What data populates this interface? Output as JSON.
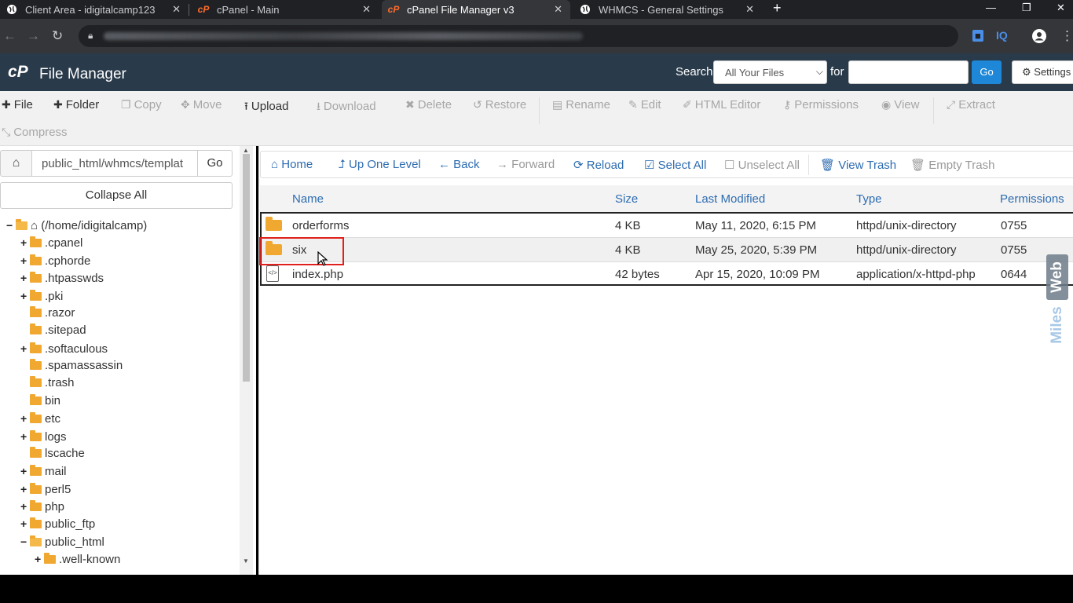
{
  "browser": {
    "tabs": [
      {
        "label": "Client Area - idigitalcamp123",
        "active": false
      },
      {
        "label": "cPanel - Main",
        "active": false
      },
      {
        "label": "cPanel File Manager v3",
        "active": true
      },
      {
        "label": "WHMCS - General Settings",
        "active": false
      }
    ],
    "new_tab": "+",
    "extension_badge": "IQ"
  },
  "header": {
    "title": "File Manager",
    "logo": "cP",
    "search_label": "Search",
    "search_scope": "All Your Files",
    "for_label": "for",
    "search_value": "",
    "go_label": "Go",
    "settings_label": "Settings"
  },
  "toolbar": {
    "items": [
      {
        "label": "File",
        "icon": "plus-icon",
        "enabled": true
      },
      {
        "label": "Folder",
        "icon": "plus-icon",
        "enabled": true
      },
      {
        "label": "Copy",
        "icon": "copy-icon",
        "enabled": false
      },
      {
        "label": "Move",
        "icon": "move-icon",
        "enabled": false
      },
      {
        "label": "Upload",
        "icon": "upload-icon",
        "enabled": true
      },
      {
        "label": "Download",
        "icon": "download-icon",
        "enabled": false
      },
      {
        "label": "Delete",
        "icon": "delete-icon",
        "enabled": false
      },
      {
        "label": "Restore",
        "icon": "restore-icon",
        "enabled": false
      },
      {
        "label": "Rename",
        "icon": "rename-icon",
        "enabled": false
      },
      {
        "label": "Edit",
        "icon": "pencil-icon",
        "enabled": false
      },
      {
        "label": "HTML Editor",
        "icon": "html-editor-icon",
        "enabled": false
      },
      {
        "label": "Permissions",
        "icon": "key-icon",
        "enabled": false
      },
      {
        "label": "View",
        "icon": "eye-icon",
        "enabled": false
      },
      {
        "label": "Extract",
        "icon": "extract-icon",
        "enabled": false
      },
      {
        "label": "Compress",
        "icon": "compress-icon",
        "enabled": false
      }
    ]
  },
  "sidebar": {
    "path": "public_html/whmcs/templat",
    "go_label": "Go",
    "collapse_label": "Collapse All",
    "tree": [
      {
        "label": "(/home/idigitalcamp)",
        "expander": "−",
        "home": true
      },
      {
        "label": ".cpanel",
        "expander": "+"
      },
      {
        "label": ".cphorde",
        "expander": "+"
      },
      {
        "label": ".htpasswds",
        "expander": "+"
      },
      {
        "label": ".pki",
        "expander": "+"
      },
      {
        "label": ".razor",
        "expander": ""
      },
      {
        "label": ".sitepad",
        "expander": ""
      },
      {
        "label": ".softaculous",
        "expander": "+"
      },
      {
        "label": ".spamassassin",
        "expander": ""
      },
      {
        "label": ".trash",
        "expander": ""
      },
      {
        "label": "bin",
        "expander": ""
      },
      {
        "label": "etc",
        "expander": "+"
      },
      {
        "label": "logs",
        "expander": "+"
      },
      {
        "label": "lscache",
        "expander": ""
      },
      {
        "label": "mail",
        "expander": "+"
      },
      {
        "label": "perl5",
        "expander": "+"
      },
      {
        "label": "php",
        "expander": "+"
      },
      {
        "label": "public_ftp",
        "expander": "+"
      },
      {
        "label": "public_html",
        "expander": "−"
      },
      {
        "label": ".well-known",
        "expander": "+"
      }
    ]
  },
  "navigation": {
    "home": "Home",
    "up": "Up One Level",
    "back": "Back",
    "forward": "Forward",
    "reload": "Reload",
    "select_all": "Select All",
    "unselect_all": "Unselect All",
    "view_trash": "View Trash",
    "empty_trash": "Empty Trash"
  },
  "table": {
    "columns": [
      "Name",
      "Size",
      "Last Modified",
      "Type",
      "Permissions"
    ],
    "rows": [
      {
        "name": "orderforms",
        "size": "4 KB",
        "modified": "May 11, 2020, 6:15 PM",
        "type": "httpd/unix-directory",
        "perms": "0755",
        "icon": "folder-icon"
      },
      {
        "name": "six",
        "size": "4 KB",
        "modified": "May 25, 2020, 5:39 PM",
        "type": "httpd/unix-directory",
        "perms": "0755",
        "icon": "folder-icon"
      },
      {
        "name": "index.php",
        "size": "42 bytes",
        "modified": "Apr 15, 2020, 10:09 PM",
        "type": "application/x-httpd-php",
        "perms": "0644",
        "icon": "php-file-icon"
      }
    ]
  },
  "watermark": "MilesWeb",
  "colors": {
    "header_bg": "#293a4a",
    "link_blue": "#2d6cb1",
    "folder": "#f0a830",
    "highlight_box": "#e0201c",
    "go_button": "#1e87d8"
  }
}
